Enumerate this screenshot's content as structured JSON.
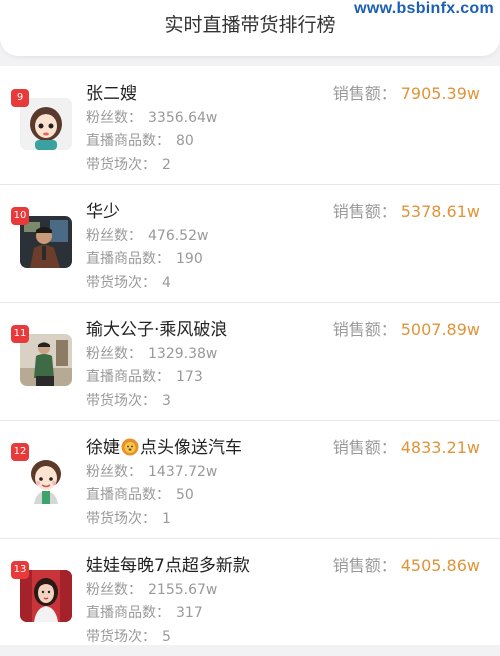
{
  "header": {
    "title": "实时直播带货排行榜"
  },
  "watermark": "www.bsbinfx.com",
  "labels": {
    "fans": "粉丝数：",
    "products": "直播商品数：",
    "sessions": "带货场次：",
    "sales": "销售额："
  },
  "streamers": [
    {
      "rank": "9",
      "name": "张二嫂",
      "fans": "3356.64w",
      "products": "80",
      "sessions": "2",
      "sales": "7905.39w"
    },
    {
      "rank": "10",
      "name": "华少",
      "fans": "476.52w",
      "products": "190",
      "sessions": "4",
      "sales": "5378.61w"
    },
    {
      "rank": "11",
      "name": "瑜大公子·乘风破浪",
      "fans": "1329.38w",
      "products": "173",
      "sessions": "3",
      "sales": "5007.89w"
    },
    {
      "rank": "12",
      "name_part1": "徐婕",
      "name_emoji": "lion-emoji",
      "name_part2": "点头像送汽车",
      "fans": "1437.72w",
      "products": "50",
      "sessions": "1",
      "sales": "4833.21w"
    },
    {
      "rank": "13",
      "name": "娃娃每晚7点超多新款",
      "fans": "2155.67w",
      "products": "317",
      "sessions": "5",
      "sales": "4505.86w"
    }
  ],
  "colors": {
    "rank_badge": "#e83a3a",
    "sales_value": "#e0943a",
    "watermark": "#1a5fb4"
  }
}
